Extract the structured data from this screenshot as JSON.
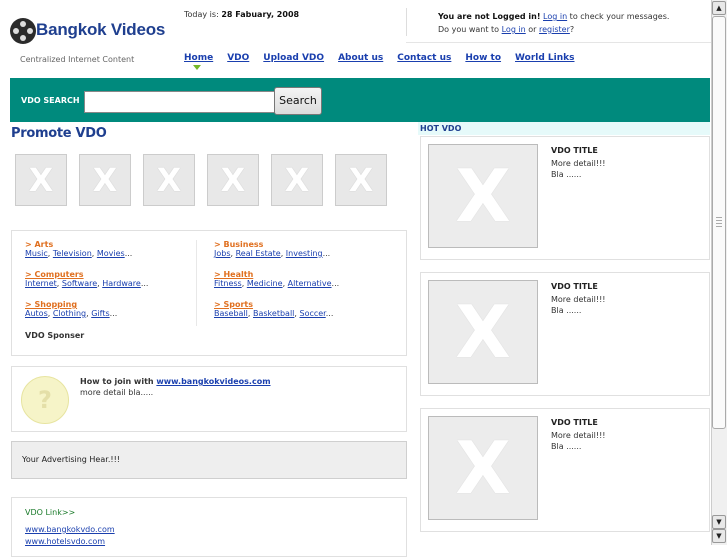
{
  "header": {
    "logo_text": "Bangkok Videos",
    "tagline": "Centralized Internet Content",
    "today_prefix": "Today is: ",
    "today_date": "28 Fabuary, 2008",
    "login_status": "You are not Logged in!",
    "login_link1": "Log in",
    "login_text1": " to check your messages.",
    "login_text2": "Do you want to ",
    "login_link2": "Log in",
    "login_text3": " or ",
    "login_link3": "register",
    "login_text4": "?"
  },
  "nav": [
    "Home",
    "VDO",
    "Upload VDO",
    "About us",
    "Contact us",
    "How to",
    "World Links"
  ],
  "search": {
    "label": "VDO SEARCH",
    "button": "Search",
    "value": ""
  },
  "promote": {
    "title": "Promote VDO",
    "thumbs": [
      "X",
      "X",
      "X",
      "X",
      "X",
      "X"
    ]
  },
  "categories": {
    "left": [
      {
        "title": "> Arts",
        "title_link": false,
        "links": [
          "Music",
          "Television",
          "Movies"
        ]
      },
      {
        "title": "> Computers",
        "title_link": true,
        "links": [
          "Internet",
          "Software",
          "Hardware"
        ]
      },
      {
        "title": "> Shopping",
        "title_link": true,
        "links": [
          "Autos",
          "Clothing",
          "Gifts"
        ]
      }
    ],
    "right": [
      {
        "title": "> Business",
        "title_link": false,
        "links": [
          "Jobs",
          "Real Estate",
          "Investing"
        ]
      },
      {
        "title": "> Health",
        "title_link": true,
        "links": [
          "Fitness",
          "Medicine",
          "Alternative"
        ]
      },
      {
        "title": "> Sports",
        "title_link": true,
        "links": [
          "Baseball",
          "Basketball",
          "Soccer"
        ]
      }
    ],
    "ellipsis": "...",
    "sponsor": "VDO Sponser"
  },
  "join": {
    "icon_glyph": "?",
    "prefix": "How to join with ",
    "link": "www.bangkokvideos.com",
    "detail": "more detail bla....."
  },
  "advert": {
    "text": "Your Advertising Hear.!!!"
  },
  "vdo_links": {
    "title": "VDO Link>>",
    "items": [
      "www.bangkokvdo.com",
      "www.hotelsvdo.com"
    ]
  },
  "hot_vdo": {
    "header": "HOT VDO",
    "items": [
      {
        "thumb": "X",
        "title": "VDO TITLE",
        "detail": "More detail!!!",
        "extra": "Bla ......"
      },
      {
        "thumb": "X",
        "title": "VDO TITLE",
        "detail": "More detail!!!",
        "extra": "Bla ......"
      },
      {
        "thumb": "X",
        "title": "VDO TITLE",
        "detail": "More detail!!!",
        "extra": "Bla ......"
      }
    ]
  },
  "scrollbar": {
    "up": "▲",
    "down": "▼",
    "down2": "▼"
  }
}
